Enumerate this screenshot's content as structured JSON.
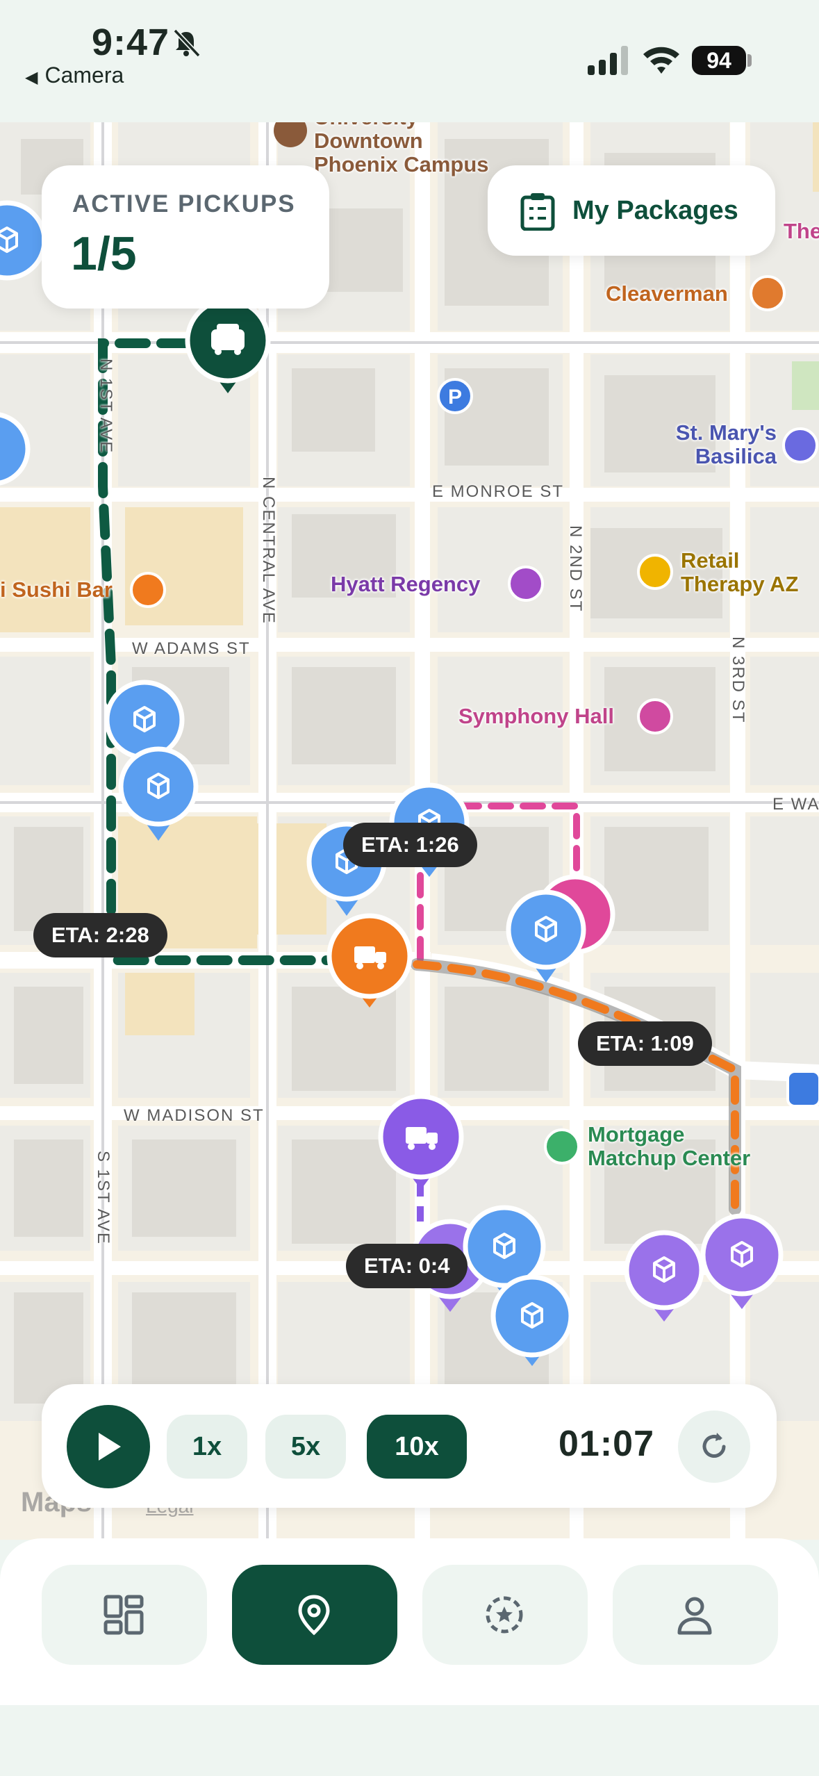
{
  "status": {
    "time": "9:47",
    "back_app": "Camera",
    "battery": "94"
  },
  "pickups": {
    "label": "ACTIVE PICKUPS",
    "value": "1/5"
  },
  "packages": {
    "label": "My Packages"
  },
  "map": {
    "pois": {
      "university": "University\nDowntown\nPhoenix Campus",
      "cleaverman": "Cleaverman",
      "the": "The",
      "st_marys": "St. Mary's\nBasilica",
      "hyatt": "Hyatt Regency",
      "sushi": "i Sushi Bar",
      "retail": "Retail\nTherapy AZ",
      "symphony": "Symphony Hall",
      "mortgage": "Mortgage\nMatchup Center"
    },
    "streets": {
      "n1st": "N 1ST AVE",
      "central": "N CENTRAL AVE",
      "monroe": "E MONROE ST",
      "adams": "W ADAMS ST",
      "n2nd": "N 2ND ST",
      "n3rd": "N 3RD ST",
      "ewa": "E WA",
      "madison": "W MADISON ST",
      "s1st": "S 1ST AVE"
    },
    "etas": {
      "eta_126": "ETA: 1:26",
      "eta_228": "ETA: 2:28",
      "eta_109": "ETA: 1:09",
      "eta_04": "ETA: 0:4"
    },
    "legal": {
      "maps": "Maps",
      "legal": "Legal"
    }
  },
  "controls": {
    "speeds": [
      "1x",
      "5x",
      "10x"
    ],
    "active_speed": "10x",
    "timer": "01:07"
  },
  "tabs": [
    "dashboard",
    "map",
    "rewards",
    "profile"
  ],
  "colors": {
    "brand_green": "#0e4f3b",
    "route_green": "#0e5a42",
    "route_pink": "#e0489a",
    "route_orange": "#f07a1e",
    "route_purple": "#8a5be6",
    "marker_blue": "#5a9ef0",
    "marker_purple": "#9a72ea",
    "marker_orange": "#f07a1e",
    "marker_pink": "#e0489a"
  }
}
